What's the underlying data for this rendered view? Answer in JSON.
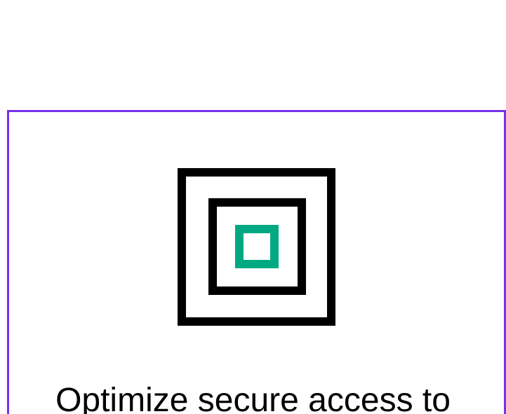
{
  "card": {
    "accent_color": "#7630ea",
    "icon_name": "nested-squares-icon",
    "icon_accent_color": "#01a982",
    "headline": "Optimize secure access to"
  }
}
